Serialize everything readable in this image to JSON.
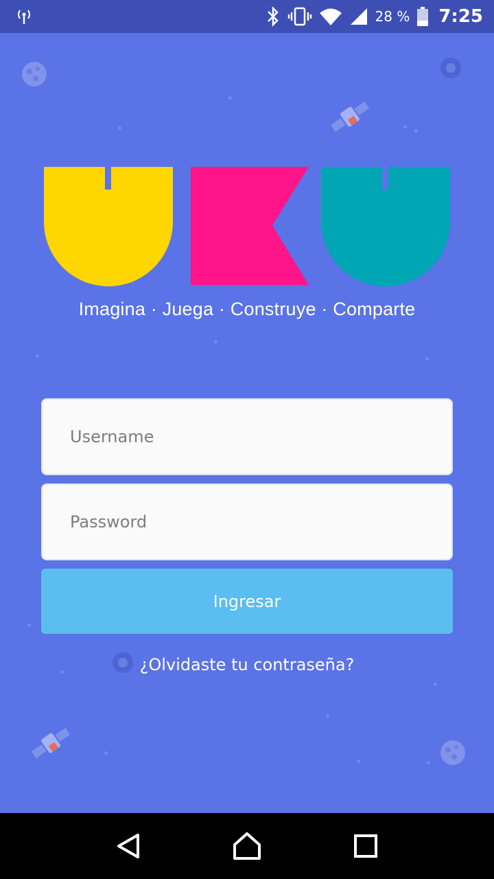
{
  "status_bar": {
    "battery_percent": "28 %",
    "time": "7:25",
    "icons": [
      "radio-tower-icon",
      "bluetooth-icon",
      "vibrate-icon",
      "wifi-icon",
      "cellular-signal-icon",
      "battery-icon"
    ]
  },
  "logo": {
    "letters": [
      "U",
      "K",
      "U"
    ],
    "colors": {
      "u1": "#ffd600",
      "k": "#ff1589",
      "u2": "#00a6b4"
    },
    "tagline": "Imagina · Juega · Construye · Comparte"
  },
  "login_form": {
    "username": {
      "placeholder": "Username",
      "value": ""
    },
    "password": {
      "placeholder": "Password",
      "value": ""
    },
    "submit_label": "Ingresar",
    "forgot_password": "¿Olvidaste tu contraseña?"
  },
  "theme": {
    "background": "#5a73e6",
    "status_bar": "#3d4fb5",
    "button": "#5bbdf0"
  },
  "nav_bar": {
    "buttons": [
      "back-icon",
      "home-icon",
      "recents-icon"
    ]
  }
}
